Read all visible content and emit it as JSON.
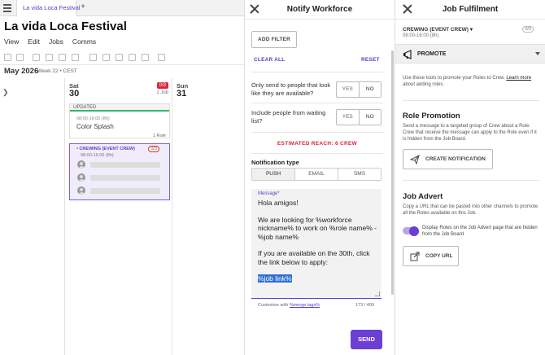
{
  "browser": {
    "active_tab": "La vida Loca Festival",
    "new_tab": "+"
  },
  "app": {
    "title": "La vida Loca Festival",
    "menu": [
      "View",
      "Edit",
      "Jobs",
      "Comms"
    ],
    "month": "May 2026",
    "week": "Week 22 • CEST"
  },
  "calendar": {
    "sat": {
      "name": "Sat",
      "num": "30",
      "badge": "0/3",
      "jobs": "1 Job"
    },
    "sun": {
      "name": "Sun",
      "num": "31"
    },
    "job_card": {
      "status": "UPDATED",
      "time": "08:00-16:00 (8h)",
      "name": "Color Splash",
      "roles": "1 Role"
    },
    "role_card": {
      "title": "• CREWING (EVENT CREW)",
      "badge": "0/3",
      "time": "08:00-16:00 (8h)"
    }
  },
  "notify": {
    "title": "Notify Workforce",
    "add_filter": "ADD FILTER",
    "clear_all": "CLEAR ALL",
    "reset": "RESET",
    "q1": "Only send to people that look like they are available?",
    "q2": "Include people from waiting list?",
    "yes": "YES",
    "no": "NO",
    "reach": "ESTIMATED REACH: 6 CREW",
    "type_label": "Notification type",
    "types": [
      "PUSH",
      "EMAIL",
      "SMS"
    ],
    "message_label": "Message*",
    "message_p1": "Hola amigos!",
    "message_p2": "We are looking for %workforce nickname% to work on %role name% - %job name%",
    "message_p3": "If you are available on the 30th, click the link below to apply:",
    "message_link": "%job link%",
    "tags_hint_prefix": "Customise with ",
    "tags_hint_link": "%merge tags%",
    "char_count": "173 / 400",
    "send": "SEND"
  },
  "fulfil": {
    "title": "Job Fulfilment",
    "role": "CREWING (EVENT CREW)",
    "role_time": "08:00-16:00 (8h)",
    "role_count": "0/3",
    "promote": "PROMOTE",
    "help_text": "Use these tools to promote your Roles to Crew. ",
    "help_link": "Learn more",
    "help_suffix": "about adding roles.",
    "role_promotion_title": "Role Promotion",
    "role_promotion_desc": "Send a message to a targeted group of Crew about a Role. Crew that receive the message can apply to the Role even if it is hidden from the Job Board.",
    "create_notification": "CREATE NOTIFICATION",
    "job_advert_title": "Job Advert",
    "job_advert_desc": "Copy a URL that can be pasted into other channels to promote all the Roles available on this Job.",
    "toggle_label": "Display Roles on the Job Advert page that are hidden from the Job Board",
    "copy_url": "COPY URL"
  },
  "colors": {
    "accent": "#6b3fd3",
    "alert": "#d9263a",
    "success": "#2fb86b"
  }
}
